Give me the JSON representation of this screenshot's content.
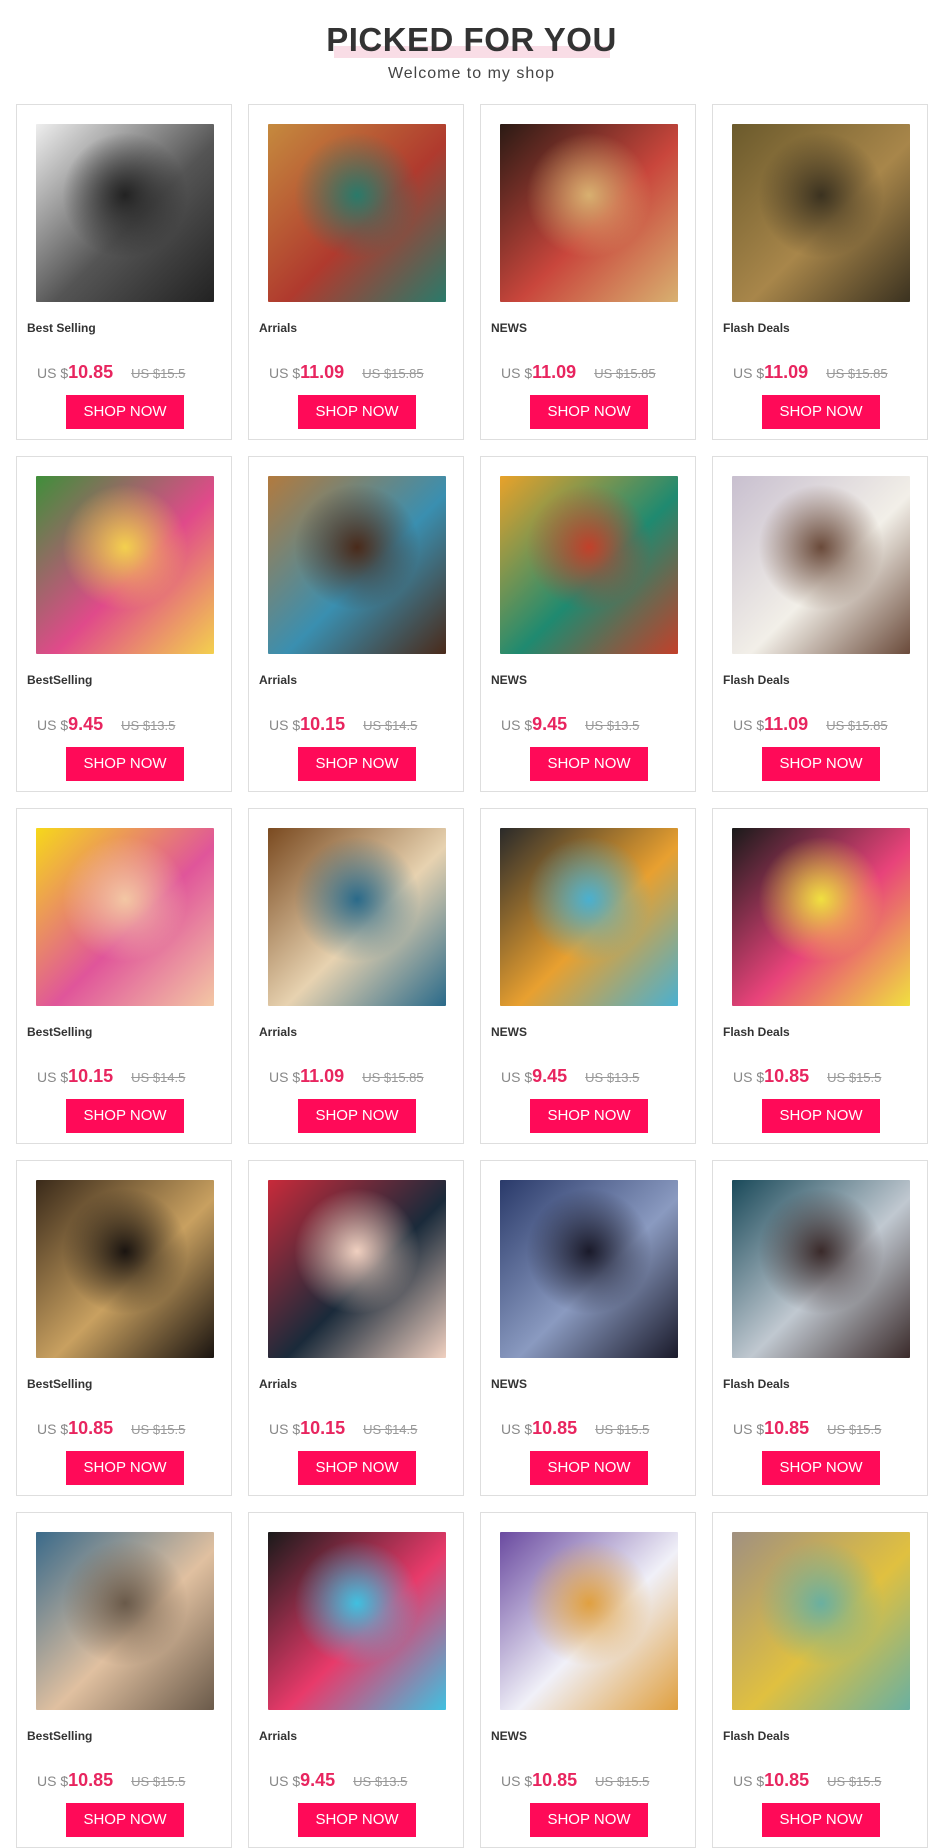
{
  "header": {
    "title": "PICKED FOR YOU",
    "subtitle": "Welcome to my shop"
  },
  "currency_prefix": "US $",
  "button_label": "SHOP NOW",
  "products": [
    {
      "category": "Best Selling",
      "price": "10.85",
      "old_price": "US $15.5",
      "image": "winged-woman-painting",
      "colors": [
        "#eeeeee",
        "#555555",
        "#222222"
      ]
    },
    {
      "category": "Arrials",
      "price": "11.09",
      "old_price": "US $15.85",
      "image": "ornate-costume-painting",
      "colors": [
        "#c58a3e",
        "#b03a2e",
        "#2a7a6a"
      ]
    },
    {
      "category": "NEWS",
      "price": "11.09",
      "old_price": "US $15.85",
      "image": "tribal-dancers-painting",
      "colors": [
        "#2b1a14",
        "#c9463c",
        "#d8b070"
      ]
    },
    {
      "category": "Flash Deals",
      "price": "11.09",
      "old_price": "US $15.85",
      "image": "woman-with-lions-painting",
      "colors": [
        "#6b5a2c",
        "#a8864a",
        "#3b3220"
      ]
    },
    {
      "category": "BestSelling",
      "price": "9.45",
      "old_price": "US $13.5",
      "image": "butterfly-eye-painting",
      "colors": [
        "#3f8f3a",
        "#e04a8a",
        "#f3d04e"
      ]
    },
    {
      "category": "Arrials",
      "price": "10.15",
      "old_price": "US $14.5",
      "image": "african-woman-headwrap-painting",
      "colors": [
        "#b27a3e",
        "#3a8fb0",
        "#4a2a1a"
      ]
    },
    {
      "category": "NEWS",
      "price": "9.45",
      "old_price": "US $13.5",
      "image": "sun-moon-painting",
      "colors": [
        "#e8a22a",
        "#1f8a70",
        "#c2402a"
      ]
    },
    {
      "category": "Flash Deals",
      "price": "11.09",
      "old_price": "US $15.85",
      "image": "woman-white-tiger-painting",
      "colors": [
        "#c8bfcf",
        "#f2efe8",
        "#6a4a3a"
      ]
    },
    {
      "category": "BestSelling",
      "price": "10.15",
      "old_price": "US $14.5",
      "image": "pop-art-woman-painting",
      "colors": [
        "#f6d81a",
        "#e0559a",
        "#f3c7a4"
      ]
    },
    {
      "category": "Arrials",
      "price": "11.09",
      "old_price": "US $15.85",
      "image": "madonna-praying-painting",
      "colors": [
        "#7a4a20",
        "#e7d2b0",
        "#2a6a8a"
      ]
    },
    {
      "category": "NEWS",
      "price": "9.45",
      "old_price": "US $13.5",
      "image": "graffiti-afro-woman-painting",
      "colors": [
        "#2a2a2a",
        "#e8a030",
        "#4ab0d0"
      ]
    },
    {
      "category": "Flash Deals",
      "price": "10.85",
      "old_price": "US $15.5",
      "image": "dream-afro-woman-painting",
      "colors": [
        "#1a1a1a",
        "#e8437a",
        "#f0e040"
      ]
    },
    {
      "category": "BestSelling",
      "price": "10.85",
      "old_price": "US $15.5",
      "image": "skull-queens-painting",
      "colors": [
        "#3a2a1a",
        "#c8a060",
        "#1a1410"
      ]
    },
    {
      "category": "Arrials",
      "price": "10.15",
      "old_price": "US $14.5",
      "image": "woman-black-hat-painting",
      "colors": [
        "#c82a3a",
        "#1a2a3a",
        "#f0d0c0"
      ]
    },
    {
      "category": "NEWS",
      "price": "10.85",
      "old_price": "US $15.5",
      "image": "woman-with-wolves-painting",
      "colors": [
        "#2a3a6a",
        "#8a9ac0",
        "#1a1a2a"
      ]
    },
    {
      "category": "Flash Deals",
      "price": "10.85",
      "old_price": "US $15.5",
      "image": "native-woman-wolf-painting",
      "colors": [
        "#1a4a5a",
        "#c0c8d0",
        "#3a2a2a"
      ]
    },
    {
      "category": "BestSelling",
      "price": "10.85",
      "old_price": "US $15.5",
      "image": "woman-wolf-moon-painting",
      "colors": [
        "#3a6a8a",
        "#e0c0a0",
        "#6a5a4a"
      ]
    },
    {
      "category": "Arrials",
      "price": "9.45",
      "old_price": "US $13.5",
      "image": "colorful-butterfly-eye-painting",
      "colors": [
        "#1a1a1a",
        "#e83a6a",
        "#40c0e0"
      ]
    },
    {
      "category": "NEWS",
      "price": "10.85",
      "old_price": "US $15.5",
      "image": "ballerina-painting",
      "colors": [
        "#6a4aa0",
        "#f0f0f8",
        "#e0a040"
      ]
    },
    {
      "category": "Flash Deals",
      "price": "10.85",
      "old_price": "US $15.5",
      "image": "curly-hair-woman-painting",
      "colors": [
        "#a09080",
        "#e0c040",
        "#6ab0a0"
      ]
    }
  ]
}
